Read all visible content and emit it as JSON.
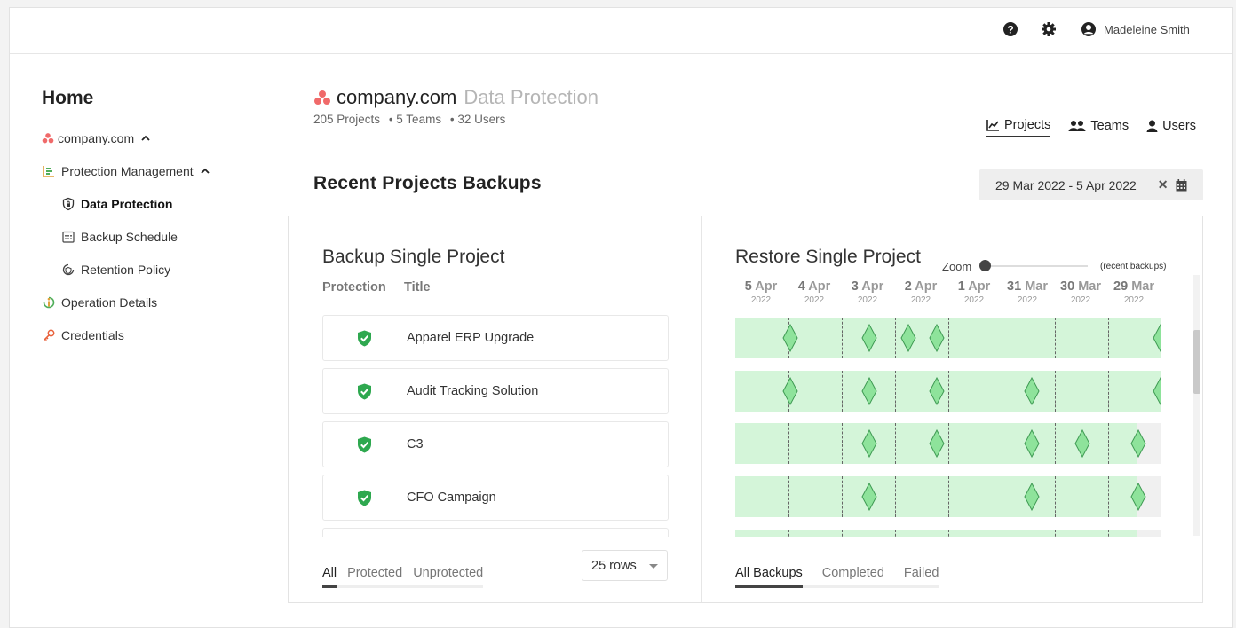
{
  "user": {
    "name": "Madeleine Smith",
    "icons": [
      "help-circle-icon",
      "gear-icon",
      "user-circle-icon"
    ]
  },
  "sidebar": {
    "home": "Home",
    "org": "company.com",
    "items": [
      {
        "label": "Protection Management",
        "icon": "chart-icon"
      },
      {
        "label": "Data Protection",
        "icon": "shield-lock-icon",
        "active": true
      },
      {
        "label": "Backup Schedule",
        "icon": "calendar-grid-icon"
      },
      {
        "label": "Retention Policy",
        "icon": "refresh-shield-icon"
      },
      {
        "label": "Operation Details",
        "icon": "info-icon"
      },
      {
        "label": "Credentials",
        "icon": "key-icon"
      }
    ]
  },
  "header": {
    "org": "company.com",
    "subtitle": "Data Protection",
    "stats": {
      "projects": "205 Projects",
      "teams": "• 5 Teams",
      "users": "• 32 Users"
    }
  },
  "view_tabs": [
    {
      "label": "Projects",
      "active": true
    },
    {
      "label": "Teams"
    },
    {
      "label": "Users"
    }
  ],
  "section": {
    "title": "Recent Projects Backups",
    "date_range": "29 Mar 2022 - 5 Apr 2022"
  },
  "backup": {
    "title": "Backup Single Project",
    "col_protection": "Protection",
    "col_title": "Title",
    "rows": [
      {
        "title": "Apparel ERP Upgrade",
        "protected": true
      },
      {
        "title": "Audit Tracking Solution",
        "protected": true
      },
      {
        "title": "C3",
        "protected": true
      },
      {
        "title": "CFO Campaign",
        "protected": true
      }
    ],
    "filters": [
      "All",
      "Protected",
      "Unprotected"
    ],
    "rows_select": "25 rows"
  },
  "restore": {
    "title": "Restore Single Project",
    "zoom_label": "Zoom",
    "zoom_note": "(recent backups)",
    "dates": [
      {
        "day": "5",
        "mon": "Apr",
        "year": "2022"
      },
      {
        "day": "4",
        "mon": "Apr",
        "year": "2022"
      },
      {
        "day": "3",
        "mon": "Apr",
        "year": "2022"
      },
      {
        "day": "2",
        "mon": "Apr",
        "year": "2022"
      },
      {
        "day": "1",
        "mon": "Apr",
        "year": "2022"
      },
      {
        "day": "31",
        "mon": "Mar",
        "year": "2022"
      },
      {
        "day": "30",
        "mon": "Mar",
        "year": "2022"
      },
      {
        "day": "29",
        "mon": "Mar",
        "year": "2022"
      }
    ],
    "filters": [
      "All Backups",
      "Completed",
      "Failed"
    ]
  },
  "colors": {
    "accent_red": "#f06a6a",
    "success_green": "#2ea84f",
    "timeline_fill": "#d4f5d9",
    "diamond": "#8ee39b"
  }
}
